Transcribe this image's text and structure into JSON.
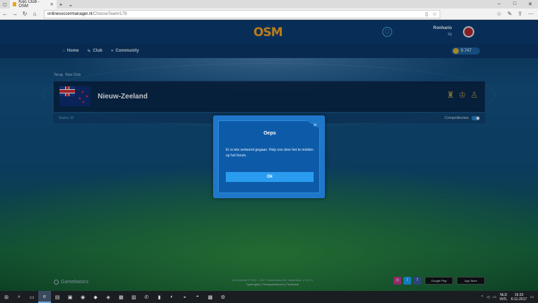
{
  "browser": {
    "tab_title": "Kies Club - OSM",
    "url_domain": "onlinesoccermanager.nl",
    "url_path": "/ChooseTeam/178"
  },
  "site": {
    "logo": "OSM",
    "manager_name": "Ronhario",
    "manager_sub": "Nij",
    "coins": "9.747",
    "nav": [
      {
        "label": "Home",
        "icon": "home-icon"
      },
      {
        "label": "Club",
        "icon": "club-icon"
      },
      {
        "label": "Community",
        "icon": "community-icon"
      }
    ],
    "breadcrumb": {
      "back": "Terug",
      "current": "Kies Club"
    },
    "club": {
      "name": "Nieuw-Zeeland"
    },
    "comp_bar": {
      "left": "Status 10",
      "right": "Competitieview"
    }
  },
  "modal": {
    "title": "Oeps",
    "message": "Er is iets verkeerd gegaan. Help ons door het te melden op het forum.",
    "ok_label": "Ok"
  },
  "footer": {
    "brand": "Gamebasics",
    "copyright": "All contents © 2001 - 2017 Gamebasics BV, Nederland. v 3.47.6",
    "links": "Spelregels | Privacystatement | Feedback",
    "google_play": "Google Play",
    "app_store": "App Store"
  },
  "taskbar": {
    "lang_top": "NLD",
    "lang_bottom": "INTL",
    "time": "19:33",
    "date": "6-11-2017"
  },
  "colors": {
    "accent": "#2a9cf0",
    "modal_bg": "#0d5ba8",
    "logo": "#f7a21c"
  }
}
